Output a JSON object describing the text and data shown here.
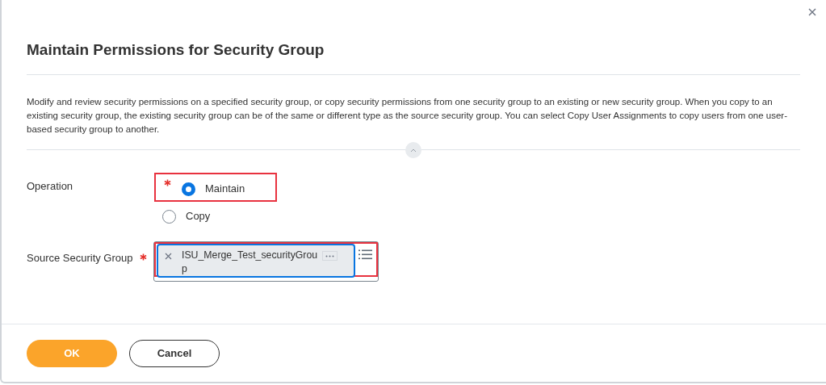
{
  "dialog": {
    "title": "Maintain Permissions for Security Group",
    "description": "Modify and review security permissions on a specified security group, or copy security permissions from one security group to an existing or new security group. When you copy to an existing security group, the existing security group can be of the same or different type as the source security group. You can select Copy User Assignments to copy users from one user-based security group to another."
  },
  "fields": [
    {
      "kind": "radio",
      "label": "Operation",
      "required": true,
      "highlighted": true,
      "options": [
        {
          "label": "Maintain",
          "selected": true
        },
        {
          "label": "Copy",
          "selected": false
        }
      ]
    },
    {
      "kind": "prompt",
      "label": "Source Security Group",
      "required": true,
      "highlighted": true,
      "value": "ISU_Merge_Test_securityGroup"
    }
  ],
  "buttons": [
    {
      "label": "OK",
      "kind": "primary"
    },
    {
      "label": "Cancel",
      "kind": "secondary"
    }
  ]
}
